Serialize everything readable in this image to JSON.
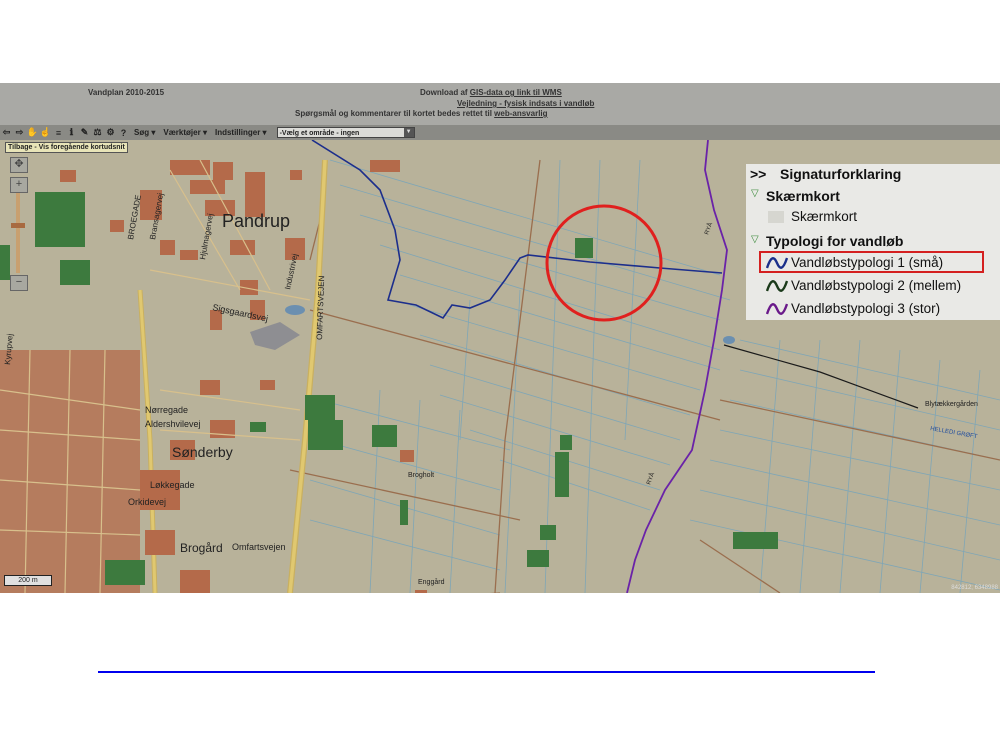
{
  "header": {
    "title": "Vandplan 2010-2015",
    "download_prefix": "Download af",
    "download_link": "GIS-data og link til WMS",
    "guide_link": "Vejledning - fysisk indsats i vandløb",
    "comment_prefix": "Spørgsmål og kommentarer til kortet bedes rettet til",
    "comment_link": "web-ansvarlig"
  },
  "toolbar": {
    "menus": [
      "Søg",
      "Værktøjer",
      "Indstillinger"
    ],
    "area_select_value": "-Vælg et område - ingen",
    "tooltip": "Tilbage - Vis foregående kortudsnit"
  },
  "map": {
    "places": {
      "pandrup": "Pandrup",
      "sonderby": "Sønderby",
      "brogaard": "Brogård",
      "brogholt": "Brogholt",
      "enggaard": "Enggård",
      "blytaekkergaarden": "Blytækkergården"
    },
    "streets": {
      "broegade": "BROEGADE",
      "bransagervej": "Bransagervej",
      "hjulmagervej": "Hjulmagervej",
      "industrivej": "Industrivej",
      "omfartsvejen_v": "OMFARTSVEJEN",
      "sigsgaardsvej": "Sigsgaardsvej",
      "norregade": "Nørregade",
      "aldershvilevej": "Aldershvilevej",
      "lokkegade": "Løkkegade",
      "orkidevej": "Orkidevej",
      "omfartsvejen_h": "Omfartsvejen",
      "kyrupvej": "Kyrupvej",
      "helledi_groft": "HELLEDI GRØFT",
      "rya1": "RYÅ",
      "rya2": "RYÅ"
    },
    "scale": "200 m",
    "coords": "842812; 6348988",
    "colors": {
      "base": "#b8b29a",
      "small_stream": "#1c2e8c",
      "large_stream": "#6a22a8",
      "forest": "#3d7a3e",
      "buildings": "#b46a4a",
      "circle": "#e0201e"
    }
  },
  "legend": {
    "toggle": ">>",
    "title": "Signaturforklaring",
    "group1": "Skærmkort",
    "group1_item": "Skærmkort",
    "group2": "Typologi for vandløb",
    "items": [
      "Vandløbstypologi 1 (små)",
      "Vandløbstypologi 2 (mellem)",
      "Vandløbstypologi 3 (stor)"
    ],
    "item_colors": [
      "#1a2f8a",
      "#1a3a1a",
      "#6a1a8a"
    ]
  }
}
